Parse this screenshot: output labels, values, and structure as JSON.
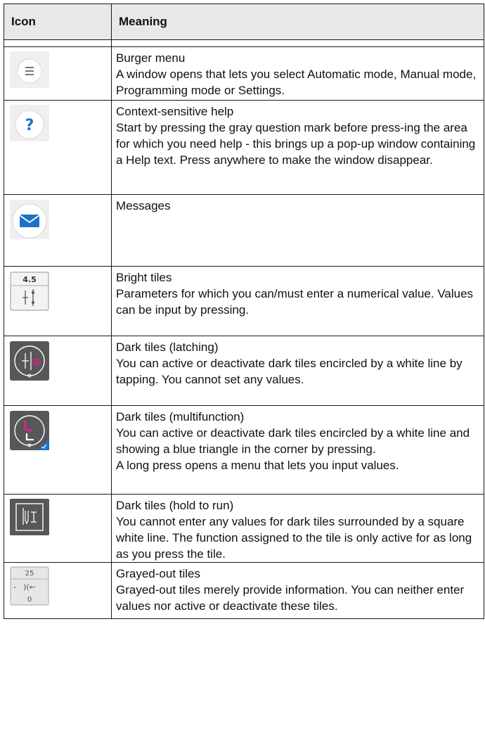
{
  "header": {
    "icon_col": "Icon",
    "meaning_col": "Meaning"
  },
  "rows": [
    {
      "icon": "burger-menu-icon",
      "title": "Burger menu",
      "desc": "A window opens that lets you select Automatic mode, Manual mode, Programming mode or Settings."
    },
    {
      "icon": "help-question-icon",
      "title": "Context-sensitive help",
      "desc": "Start by pressing the gray question mark before press-ing the area for which you need help - this brings up a pop-up window containing a Help text. Press anywhere to make the window disappear."
    },
    {
      "icon": "envelope-icon",
      "title": "Messages",
      "desc": ""
    },
    {
      "icon": "bright-tile-icon",
      "title": "Bright tiles",
      "tile_value": "4.5",
      "desc": "Parameters for which you can/must enter a numerical value. Values can be input by pressing."
    },
    {
      "icon": "dark-tile-latching-icon",
      "title": "Dark tiles (latching)",
      "desc": "You can active or deactivate dark tiles encircled by a white line by tapping. You cannot set any values."
    },
    {
      "icon": "dark-tile-multifunction-icon",
      "title": "Dark tiles (multifunction)",
      "desc": "You can active or deactivate dark tiles encircled by a white line and showing a blue triangle in the corner by pressing.",
      "desc2": "A long press opens a menu that lets you input values."
    },
    {
      "icon": "dark-tile-hold-icon",
      "title": "Dark tiles (hold to run)",
      "desc": "You cannot enter any values for dark tiles surrounded by a square white line. The function assigned to the tile is only active for as long as you press the tile."
    },
    {
      "icon": "grayed-tile-icon",
      "title": "Grayed-out tiles",
      "tile_value": "25",
      "tile_value2": "0",
      "desc": "Grayed-out tiles merely provide information. You can neither enter values nor active or deactivate these tiles."
    }
  ],
  "colors": {
    "header_bg": "#e8e8e8",
    "accent_blue": "#1a73c9",
    "dark_tile": "#555759",
    "magenta": "#d6248a"
  }
}
